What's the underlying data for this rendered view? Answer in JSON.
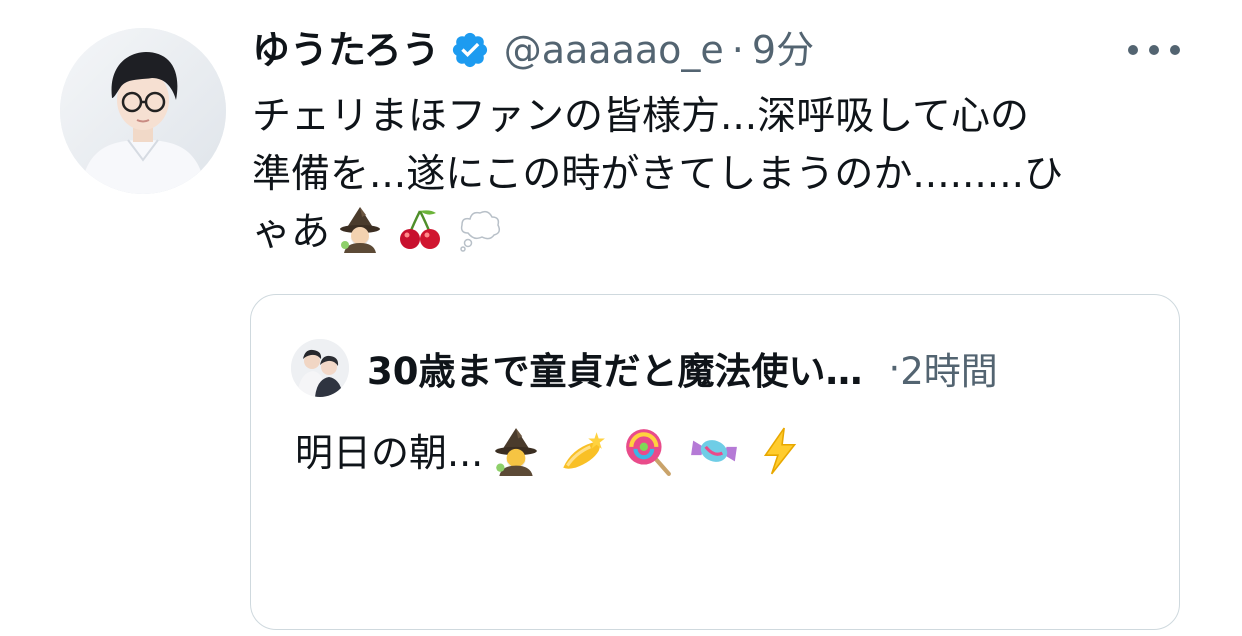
{
  "tweet": {
    "display_name": "ゆうたろう",
    "verified": true,
    "handle": "@aaaaao_e",
    "separator": "·",
    "time": "9分",
    "text_line1": "チェリまほファンの皆様方...深呼吸して心の",
    "text_line2": "準備を...遂にこの時がきてしまうのか.........ひ",
    "text_line3": "ゃあ",
    "emojis": [
      "wizard-emoji",
      "cherries-emoji",
      "thought-balloon-emoji"
    ]
  },
  "quoted_tweet": {
    "display_name": "30歳まで童貞だと魔法使い…",
    "separator": "·",
    "time": "2時間",
    "text": "明日の朝...",
    "emojis": [
      "wizard-emoji",
      "dizzy-emoji",
      "lollipop-emoji",
      "candy-emoji",
      "high-voltage-emoji"
    ]
  },
  "icons": {
    "verified": "verified-badge-icon",
    "more": "more-options-icon"
  },
  "colors": {
    "text_primary": "#0f1419",
    "text_secondary": "#536471",
    "verified_blue": "#1d9bf0",
    "card_border": "#cfd9de"
  }
}
